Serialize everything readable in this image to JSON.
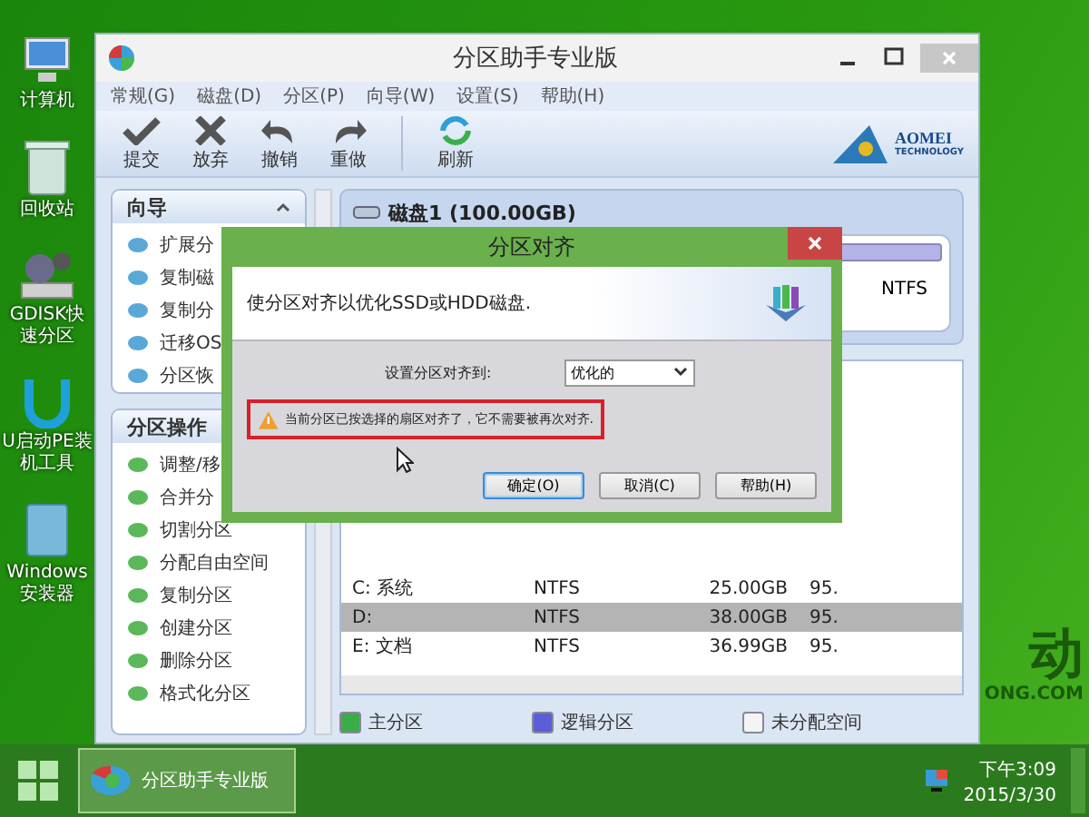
{
  "desktop": {
    "icons": [
      {
        "label": "计算机",
        "kind": "computer"
      },
      {
        "label": "回收站",
        "kind": "recycle"
      },
      {
        "label": "GDISK快速分区",
        "kind": "gears"
      },
      {
        "label": "U启动PE装机工具",
        "kind": "u"
      },
      {
        "label": "Windows安装器",
        "kind": "installer"
      }
    ],
    "wallpaper_logo": {
      "text": "动",
      "subtext": "ONG.COM"
    }
  },
  "main_window": {
    "title": "分区助手专业版",
    "menu": [
      "常规(G)",
      "磁盘(D)",
      "分区(P)",
      "向导(W)",
      "设置(S)",
      "帮助(H)"
    ],
    "toolbar": [
      {
        "label": "提交",
        "kind": "check"
      },
      {
        "label": "放弃",
        "kind": "cross"
      },
      {
        "label": "撤销",
        "kind": "undo"
      },
      {
        "label": "重做",
        "kind": "redo"
      },
      {
        "label": "刷新",
        "kind": "refresh"
      }
    ],
    "logo": {
      "name": "AOMEI",
      "tagline": "TECHNOLOGY"
    },
    "wizard_panel": {
      "title": "向导",
      "items": [
        "扩展分",
        "复制磁",
        "复制分",
        "迁移OS",
        "分区恢"
      ]
    },
    "operations_panel": {
      "title": "分区操作",
      "items": [
        "调整/移",
        "合并分",
        "切割分区",
        "分配自由空间",
        "复制分区",
        "创建分区",
        "删除分区",
        "格式化分区"
      ]
    },
    "disk": {
      "name": "磁盘1 (100.00GB)",
      "file_system": "NTFS"
    },
    "partitions": [
      {
        "name": "C: 系统",
        "file_system": "NTFS",
        "capacity": "25.00GB",
        "column_4": "95.",
        "selected": false
      },
      {
        "name": "D:",
        "file_system": "NTFS",
        "capacity": "38.00GB",
        "column_4": "95.",
        "selected": true
      },
      {
        "name": "E: 文档",
        "file_system": "NTFS",
        "capacity": "36.99GB",
        "column_4": "95.",
        "selected": false
      }
    ],
    "legend": [
      {
        "label": "主分区",
        "color": "#3cab4a"
      },
      {
        "label": "逻辑分区",
        "color": "#5b5fd6"
      },
      {
        "label": "未分配空间",
        "color": "#f4f4f4"
      }
    ]
  },
  "dialog": {
    "title": "分区对齐",
    "description": "使分区对齐以优化SSD或HDD磁盘.",
    "align_label": "设置分区对齐到:",
    "align_value": "优化的",
    "warning": "当前分区已按选择的扇区对齐了，它不需要被再次对齐.",
    "buttons": [
      {
        "label": "确定(O)",
        "selected": true
      },
      {
        "label": "取消(C)",
        "selected": false
      },
      {
        "label": "帮助(H)",
        "selected": false
      }
    ]
  },
  "taskbar": {
    "tasks": [
      {
        "label": "分区助手专业版",
        "selected": true
      }
    ],
    "time": "下午3:09",
    "date": "2015/3/30"
  }
}
